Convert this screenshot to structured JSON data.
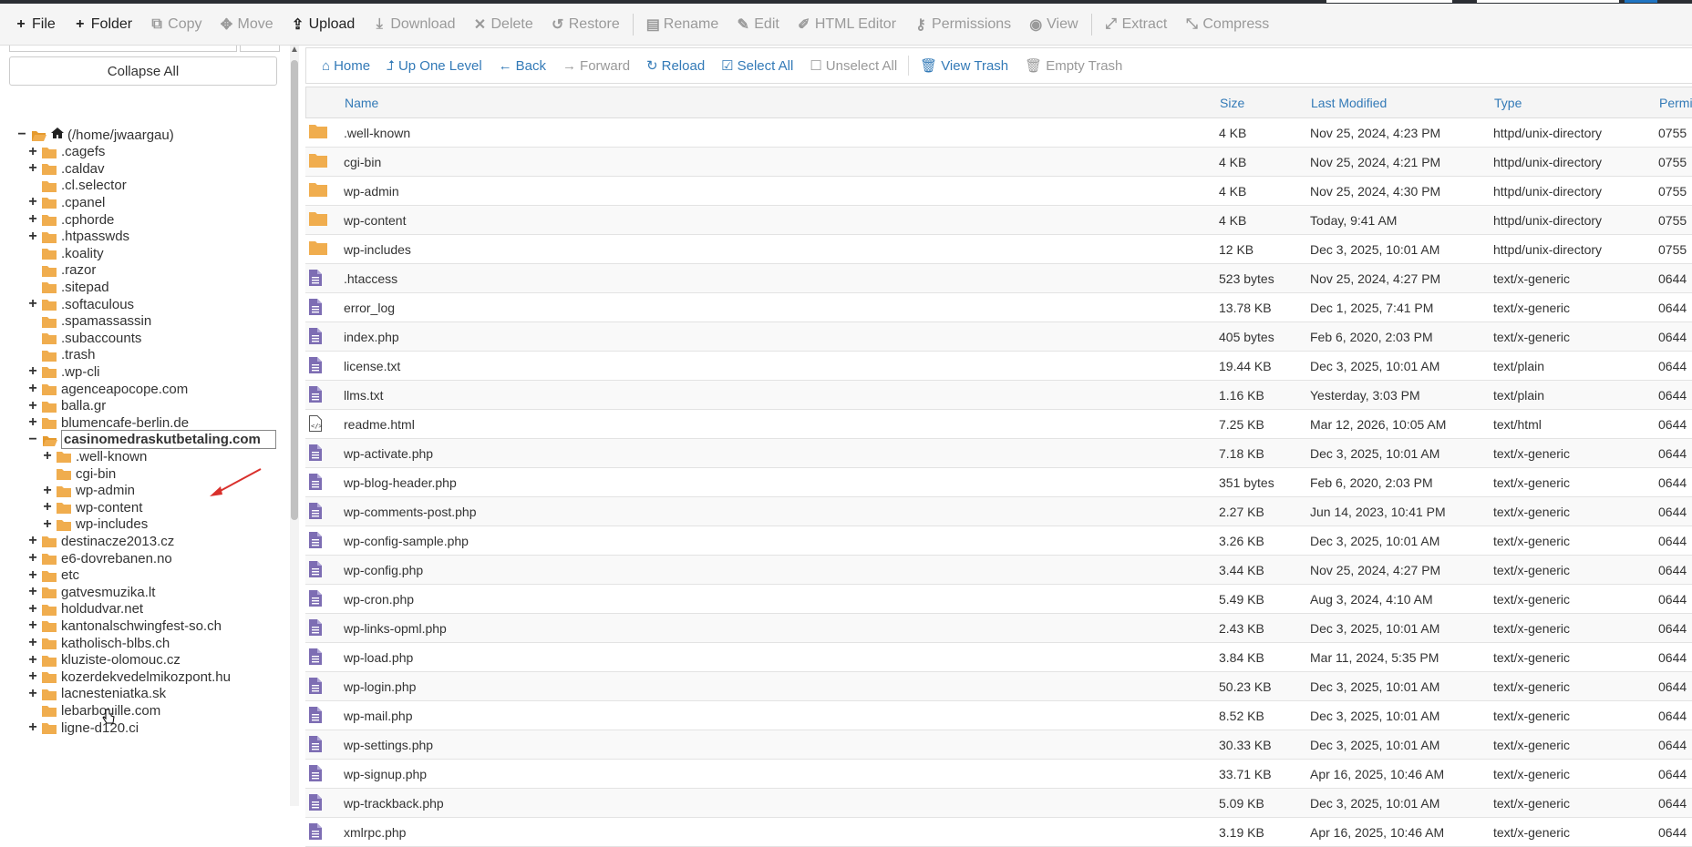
{
  "toolbar": {
    "file": "File",
    "folder": "Folder",
    "copy": "Copy",
    "move": "Move",
    "upload": "Upload",
    "download": "Download",
    "delete": "Delete",
    "restore": "Restore",
    "rename": "Rename",
    "edit": "Edit",
    "html_editor": "HTML Editor",
    "permissions": "Permissions",
    "view": "View",
    "extract": "Extract",
    "compress": "Compress"
  },
  "sidebar": {
    "collapse_all": "Collapse All",
    "tree": [
      {
        "label": "(/home/jwaargau)",
        "toggle": "−",
        "level": 0,
        "root": true,
        "open": true
      },
      {
        "label": ".cagefs",
        "toggle": "+",
        "level": 1
      },
      {
        "label": ".caldav",
        "toggle": "+",
        "level": 1
      },
      {
        "label": ".cl.selector",
        "toggle": "",
        "level": 1
      },
      {
        "label": ".cpanel",
        "toggle": "+",
        "level": 1
      },
      {
        "label": ".cphorde",
        "toggle": "+",
        "level": 1
      },
      {
        "label": ".htpasswds",
        "toggle": "+",
        "level": 1
      },
      {
        "label": ".koality",
        "toggle": "",
        "level": 1
      },
      {
        "label": ".razor",
        "toggle": "",
        "level": 1
      },
      {
        "label": ".sitepad",
        "toggle": "",
        "level": 1
      },
      {
        "label": ".softaculous",
        "toggle": "+",
        "level": 1
      },
      {
        "label": ".spamassassin",
        "toggle": "",
        "level": 1
      },
      {
        "label": ".subaccounts",
        "toggle": "",
        "level": 1
      },
      {
        "label": ".trash",
        "toggle": "",
        "level": 1
      },
      {
        "label": ".wp-cli",
        "toggle": "+",
        "level": 1
      },
      {
        "label": "agenceapocope.com",
        "toggle": "+",
        "level": 1
      },
      {
        "label": "balla.gr",
        "toggle": "+",
        "level": 1
      },
      {
        "label": "blumencafe-berlin.de",
        "toggle": "+",
        "level": 1
      },
      {
        "label": "casinomedraskutbetaling.com",
        "toggle": "−",
        "level": 1,
        "selected": true,
        "open": true
      },
      {
        "label": ".well-known",
        "toggle": "+",
        "level": 2
      },
      {
        "label": "cgi-bin",
        "toggle": "",
        "level": 2
      },
      {
        "label": "wp-admin",
        "toggle": "+",
        "level": 2
      },
      {
        "label": "wp-content",
        "toggle": "+",
        "level": 2
      },
      {
        "label": "wp-includes",
        "toggle": "+",
        "level": 2
      },
      {
        "label": "destinacze2013.cz",
        "toggle": "+",
        "level": 1
      },
      {
        "label": "e6-dovrebanen.no",
        "toggle": "+",
        "level": 1
      },
      {
        "label": "etc",
        "toggle": "+",
        "level": 1
      },
      {
        "label": "gatvesmuzika.lt",
        "toggle": "+",
        "level": 1
      },
      {
        "label": "holdudvar.net",
        "toggle": "+",
        "level": 1
      },
      {
        "label": "kantonalschwingfest-so.ch",
        "toggle": "+",
        "level": 1
      },
      {
        "label": "katholisch-blbs.ch",
        "toggle": "+",
        "level": 1
      },
      {
        "label": "kluziste-olomouc.cz",
        "toggle": "+",
        "level": 1
      },
      {
        "label": "kozerdekvedelmikozpont.hu",
        "toggle": "+",
        "level": 1
      },
      {
        "label": "lacnesteniatka.sk",
        "toggle": "+",
        "level": 1
      },
      {
        "label": "lebarbouille.com",
        "toggle": "",
        "level": 1
      },
      {
        "label": "ligne-d120.ci",
        "toggle": "+",
        "level": 1
      }
    ]
  },
  "nav": {
    "home": "Home",
    "up_one_level": "Up One Level",
    "back": "Back",
    "forward": "Forward",
    "reload": "Reload",
    "select_all": "Select All",
    "unselect_all": "Unselect All",
    "view_trash": "View Trash",
    "empty_trash": "Empty Trash"
  },
  "table": {
    "headers": {
      "name": "Name",
      "size": "Size",
      "modified": "Last Modified",
      "type": "Type",
      "perms": "Permis"
    },
    "rows": [
      {
        "name": ".well-known",
        "size": "4 KB",
        "modified": "Nov 25, 2024, 4:23 PM",
        "type": "httpd/unix-directory",
        "perms": "0755",
        "icon": "folder"
      },
      {
        "name": "cgi-bin",
        "size": "4 KB",
        "modified": "Nov 25, 2024, 4:21 PM",
        "type": "httpd/unix-directory",
        "perms": "0755",
        "icon": "folder"
      },
      {
        "name": "wp-admin",
        "size": "4 KB",
        "modified": "Nov 25, 2024, 4:30 PM",
        "type": "httpd/unix-directory",
        "perms": "0755",
        "icon": "folder"
      },
      {
        "name": "wp-content",
        "size": "4 KB",
        "modified": "Today, 9:41 AM",
        "type": "httpd/unix-directory",
        "perms": "0755",
        "icon": "folder"
      },
      {
        "name": "wp-includes",
        "size": "12 KB",
        "modified": "Dec 3, 2025, 10:01 AM",
        "type": "httpd/unix-directory",
        "perms": "0755",
        "icon": "folder"
      },
      {
        "name": ".htaccess",
        "size": "523 bytes",
        "modified": "Nov 25, 2024, 4:27 PM",
        "type": "text/x-generic",
        "perms": "0644",
        "icon": "file"
      },
      {
        "name": "error_log",
        "size": "13.78 KB",
        "modified": "Dec 1, 2025, 7:41 PM",
        "type": "text/x-generic",
        "perms": "0644",
        "icon": "file"
      },
      {
        "name": "index.php",
        "size": "405 bytes",
        "modified": "Feb 6, 2020, 2:03 PM",
        "type": "text/x-generic",
        "perms": "0644",
        "icon": "file"
      },
      {
        "name": "license.txt",
        "size": "19.44 KB",
        "modified": "Dec 3, 2025, 10:01 AM",
        "type": "text/plain",
        "perms": "0644",
        "icon": "file"
      },
      {
        "name": "llms.txt",
        "size": "1.16 KB",
        "modified": "Yesterday, 3:03 PM",
        "type": "text/plain",
        "perms": "0644",
        "icon": "file"
      },
      {
        "name": "readme.html",
        "size": "7.25 KB",
        "modified": "Mar 12, 2026, 10:05 AM",
        "type": "text/html",
        "perms": "0644",
        "icon": "code"
      },
      {
        "name": "wp-activate.php",
        "size": "7.18 KB",
        "modified": "Dec 3, 2025, 10:01 AM",
        "type": "text/x-generic",
        "perms": "0644",
        "icon": "file"
      },
      {
        "name": "wp-blog-header.php",
        "size": "351 bytes",
        "modified": "Feb 6, 2020, 2:03 PM",
        "type": "text/x-generic",
        "perms": "0644",
        "icon": "file"
      },
      {
        "name": "wp-comments-post.php",
        "size": "2.27 KB",
        "modified": "Jun 14, 2023, 10:41 PM",
        "type": "text/x-generic",
        "perms": "0644",
        "icon": "file"
      },
      {
        "name": "wp-config-sample.php",
        "size": "3.26 KB",
        "modified": "Dec 3, 2025, 10:01 AM",
        "type": "text/x-generic",
        "perms": "0644",
        "icon": "file"
      },
      {
        "name": "wp-config.php",
        "size": "3.44 KB",
        "modified": "Nov 25, 2024, 4:27 PM",
        "type": "text/x-generic",
        "perms": "0644",
        "icon": "file"
      },
      {
        "name": "wp-cron.php",
        "size": "5.49 KB",
        "modified": "Aug 3, 2024, 4:10 AM",
        "type": "text/x-generic",
        "perms": "0644",
        "icon": "file"
      },
      {
        "name": "wp-links-opml.php",
        "size": "2.43 KB",
        "modified": "Dec 3, 2025, 10:01 AM",
        "type": "text/x-generic",
        "perms": "0644",
        "icon": "file"
      },
      {
        "name": "wp-load.php",
        "size": "3.84 KB",
        "modified": "Mar 11, 2024, 5:35 PM",
        "type": "text/x-generic",
        "perms": "0644",
        "icon": "file"
      },
      {
        "name": "wp-login.php",
        "size": "50.23 KB",
        "modified": "Dec 3, 2025, 10:01 AM",
        "type": "text/x-generic",
        "perms": "0644",
        "icon": "file"
      },
      {
        "name": "wp-mail.php",
        "size": "8.52 KB",
        "modified": "Dec 3, 2025, 10:01 AM",
        "type": "text/x-generic",
        "perms": "0644",
        "icon": "file"
      },
      {
        "name": "wp-settings.php",
        "size": "30.33 KB",
        "modified": "Dec 3, 2025, 10:01 AM",
        "type": "text/x-generic",
        "perms": "0644",
        "icon": "file"
      },
      {
        "name": "wp-signup.php",
        "size": "33.71 KB",
        "modified": "Apr 16, 2025, 10:46 AM",
        "type": "text/x-generic",
        "perms": "0644",
        "icon": "file"
      },
      {
        "name": "wp-trackback.php",
        "size": "5.09 KB",
        "modified": "Dec 3, 2025, 10:01 AM",
        "type": "text/x-generic",
        "perms": "0644",
        "icon": "file"
      },
      {
        "name": "xmlrpc.php",
        "size": "3.19 KB",
        "modified": "Apr 16, 2025, 10:46 AM",
        "type": "text/x-generic",
        "perms": "0644",
        "icon": "file"
      }
    ]
  },
  "colors": {
    "folder": "#f0ad4e",
    "file_icon": "#7d6db3",
    "link": "#337ab7",
    "annotation_arrow": "#d9302c"
  }
}
